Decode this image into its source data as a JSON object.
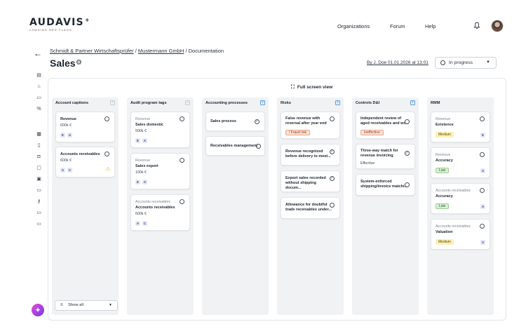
{
  "brand": {
    "name": "AUDAVIS",
    "tagline": "CHASING RED FLAGS"
  },
  "nav": {
    "organizations": "Organizations",
    "forum": "Forum",
    "help": "Help"
  },
  "breadcrumb": {
    "client": "Schmidt & Partner Wirtschaftsprüfer",
    "company": "Mustermann GmbH",
    "current": "Documentation",
    "sep": "/"
  },
  "page": {
    "title": "Sales",
    "byline": "By J. Doe 01.01.2026 at 13:01",
    "status": "In progress",
    "fullscreen": "Full screen view"
  },
  "columns": {
    "account_captions": {
      "title": "Account captions",
      "cards": [
        {
          "main": "Revenue",
          "amount": "600k €",
          "tags": [
            "E",
            "A"
          ]
        },
        {
          "main": "Accounts receivables",
          "amount": "600k €",
          "tags": [
            "A",
            "C"
          ],
          "warning": "⚠"
        }
      ],
      "show_all": "Show all"
    },
    "audit_tags": {
      "title": "Audit program tags",
      "cards": [
        {
          "pre": "Revenue",
          "main": "Sales domestic",
          "amount": "500k €",
          "tags": [
            "E",
            "A"
          ]
        },
        {
          "pre": "Revenue",
          "main": "Sales export",
          "amount": "100k €",
          "tags": [
            "E",
            "A"
          ]
        },
        {
          "pre": "Accounts receivables",
          "main": "Accounts receivables",
          "amount": "600k €",
          "tags": [
            "A",
            "C"
          ]
        }
      ]
    },
    "processes": {
      "title": "Accounting processes",
      "cards": [
        {
          "main": "Sales process"
        },
        {
          "main": "Receivables management"
        }
      ]
    },
    "risks": {
      "title": "Risks",
      "cards": [
        {
          "main": "False revenue with reversal after year end",
          "pill": "! Fraud risk"
        },
        {
          "main": "Revenue recognized before delivery to meet..."
        },
        {
          "main": "Export sales recorded without shipping docum..."
        },
        {
          "main": "Allowance for doubtful trade receivables under..."
        }
      ]
    },
    "controls": {
      "title": "Controls D&I",
      "cards": [
        {
          "main": "Independent review of aged receivables and wr...",
          "pill": "Ineffective"
        },
        {
          "main": "Three-way match for revenue invoicing",
          "sub": "Effective"
        },
        {
          "main": "System-enforced shipping/invoice matchi..."
        }
      ]
    },
    "rmm": {
      "title": "RMM",
      "cards": [
        {
          "pre": "Revenue",
          "main": "Existence",
          "level": "Medium",
          "tag": "E"
        },
        {
          "pre": "Revenue",
          "main": "Accuracy",
          "level": "Low",
          "tag": "A"
        },
        {
          "pre": "Accounts receivables",
          "main": "Accuracy",
          "level": "Low",
          "tag": "A"
        },
        {
          "pre": "Accounts receivables",
          "main": "Valuation",
          "level": "Medium",
          "tag": "V"
        }
      ]
    }
  },
  "colors": {
    "accent": "#5a9bd8",
    "medium": "#fbf0b8",
    "low": "#d8f0d5",
    "risk": "#fde3d6"
  }
}
